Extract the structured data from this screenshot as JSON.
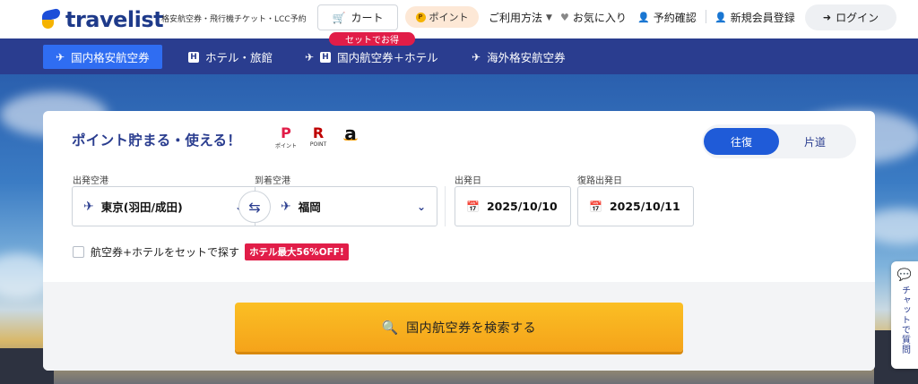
{
  "header": {
    "logo_text": "travelist",
    "tagline": "格安航空券・飛行機チケット・LCC予約",
    "cart_label": "カート",
    "cart_badge": "セットでお得",
    "point_label": "ポイント",
    "point_coin": "P",
    "usage_label": "ご利用方法",
    "favorites_label": "お気に入り",
    "booking_label": "予約確認",
    "register_label": "新規会員登録",
    "login_label": "ログイン"
  },
  "tabs": [
    {
      "label": "国内格安航空券"
    },
    {
      "label": "ホテル・旅館"
    },
    {
      "label": "国内航空券＋ホテル"
    },
    {
      "label": "海外格安航空券"
    }
  ],
  "search": {
    "title": "ポイント貯まる・使える！",
    "pay_icons": [
      {
        "mark": "P",
        "sub": "ポイント",
        "color": "#e11d48"
      },
      {
        "mark": "R",
        "sub": "POINT",
        "color": "#bf0000"
      },
      {
        "mark": "a",
        "sub": "",
        "color": "#111111"
      }
    ],
    "trip_options": [
      "往復",
      "片道"
    ],
    "from_label": "出発空港",
    "from_value": "東京(羽田/成田)",
    "to_label": "到着空港",
    "to_value": "福岡",
    "depart_label": "出発日",
    "depart_value": "2025/10/10",
    "return_label": "復路出発日",
    "return_value": "2025/10/11",
    "set_label": "航空券+ホテルをセットで探す",
    "set_badge": "ホテル最大56%OFF!",
    "search_button": "国内航空券を検索する"
  },
  "chat": {
    "label": "チャットで質問"
  },
  "colors": {
    "brand": "#2a3d8f",
    "accent": "#1f5bd8",
    "badge": "#e11d48",
    "cta": "#f5a31a"
  }
}
